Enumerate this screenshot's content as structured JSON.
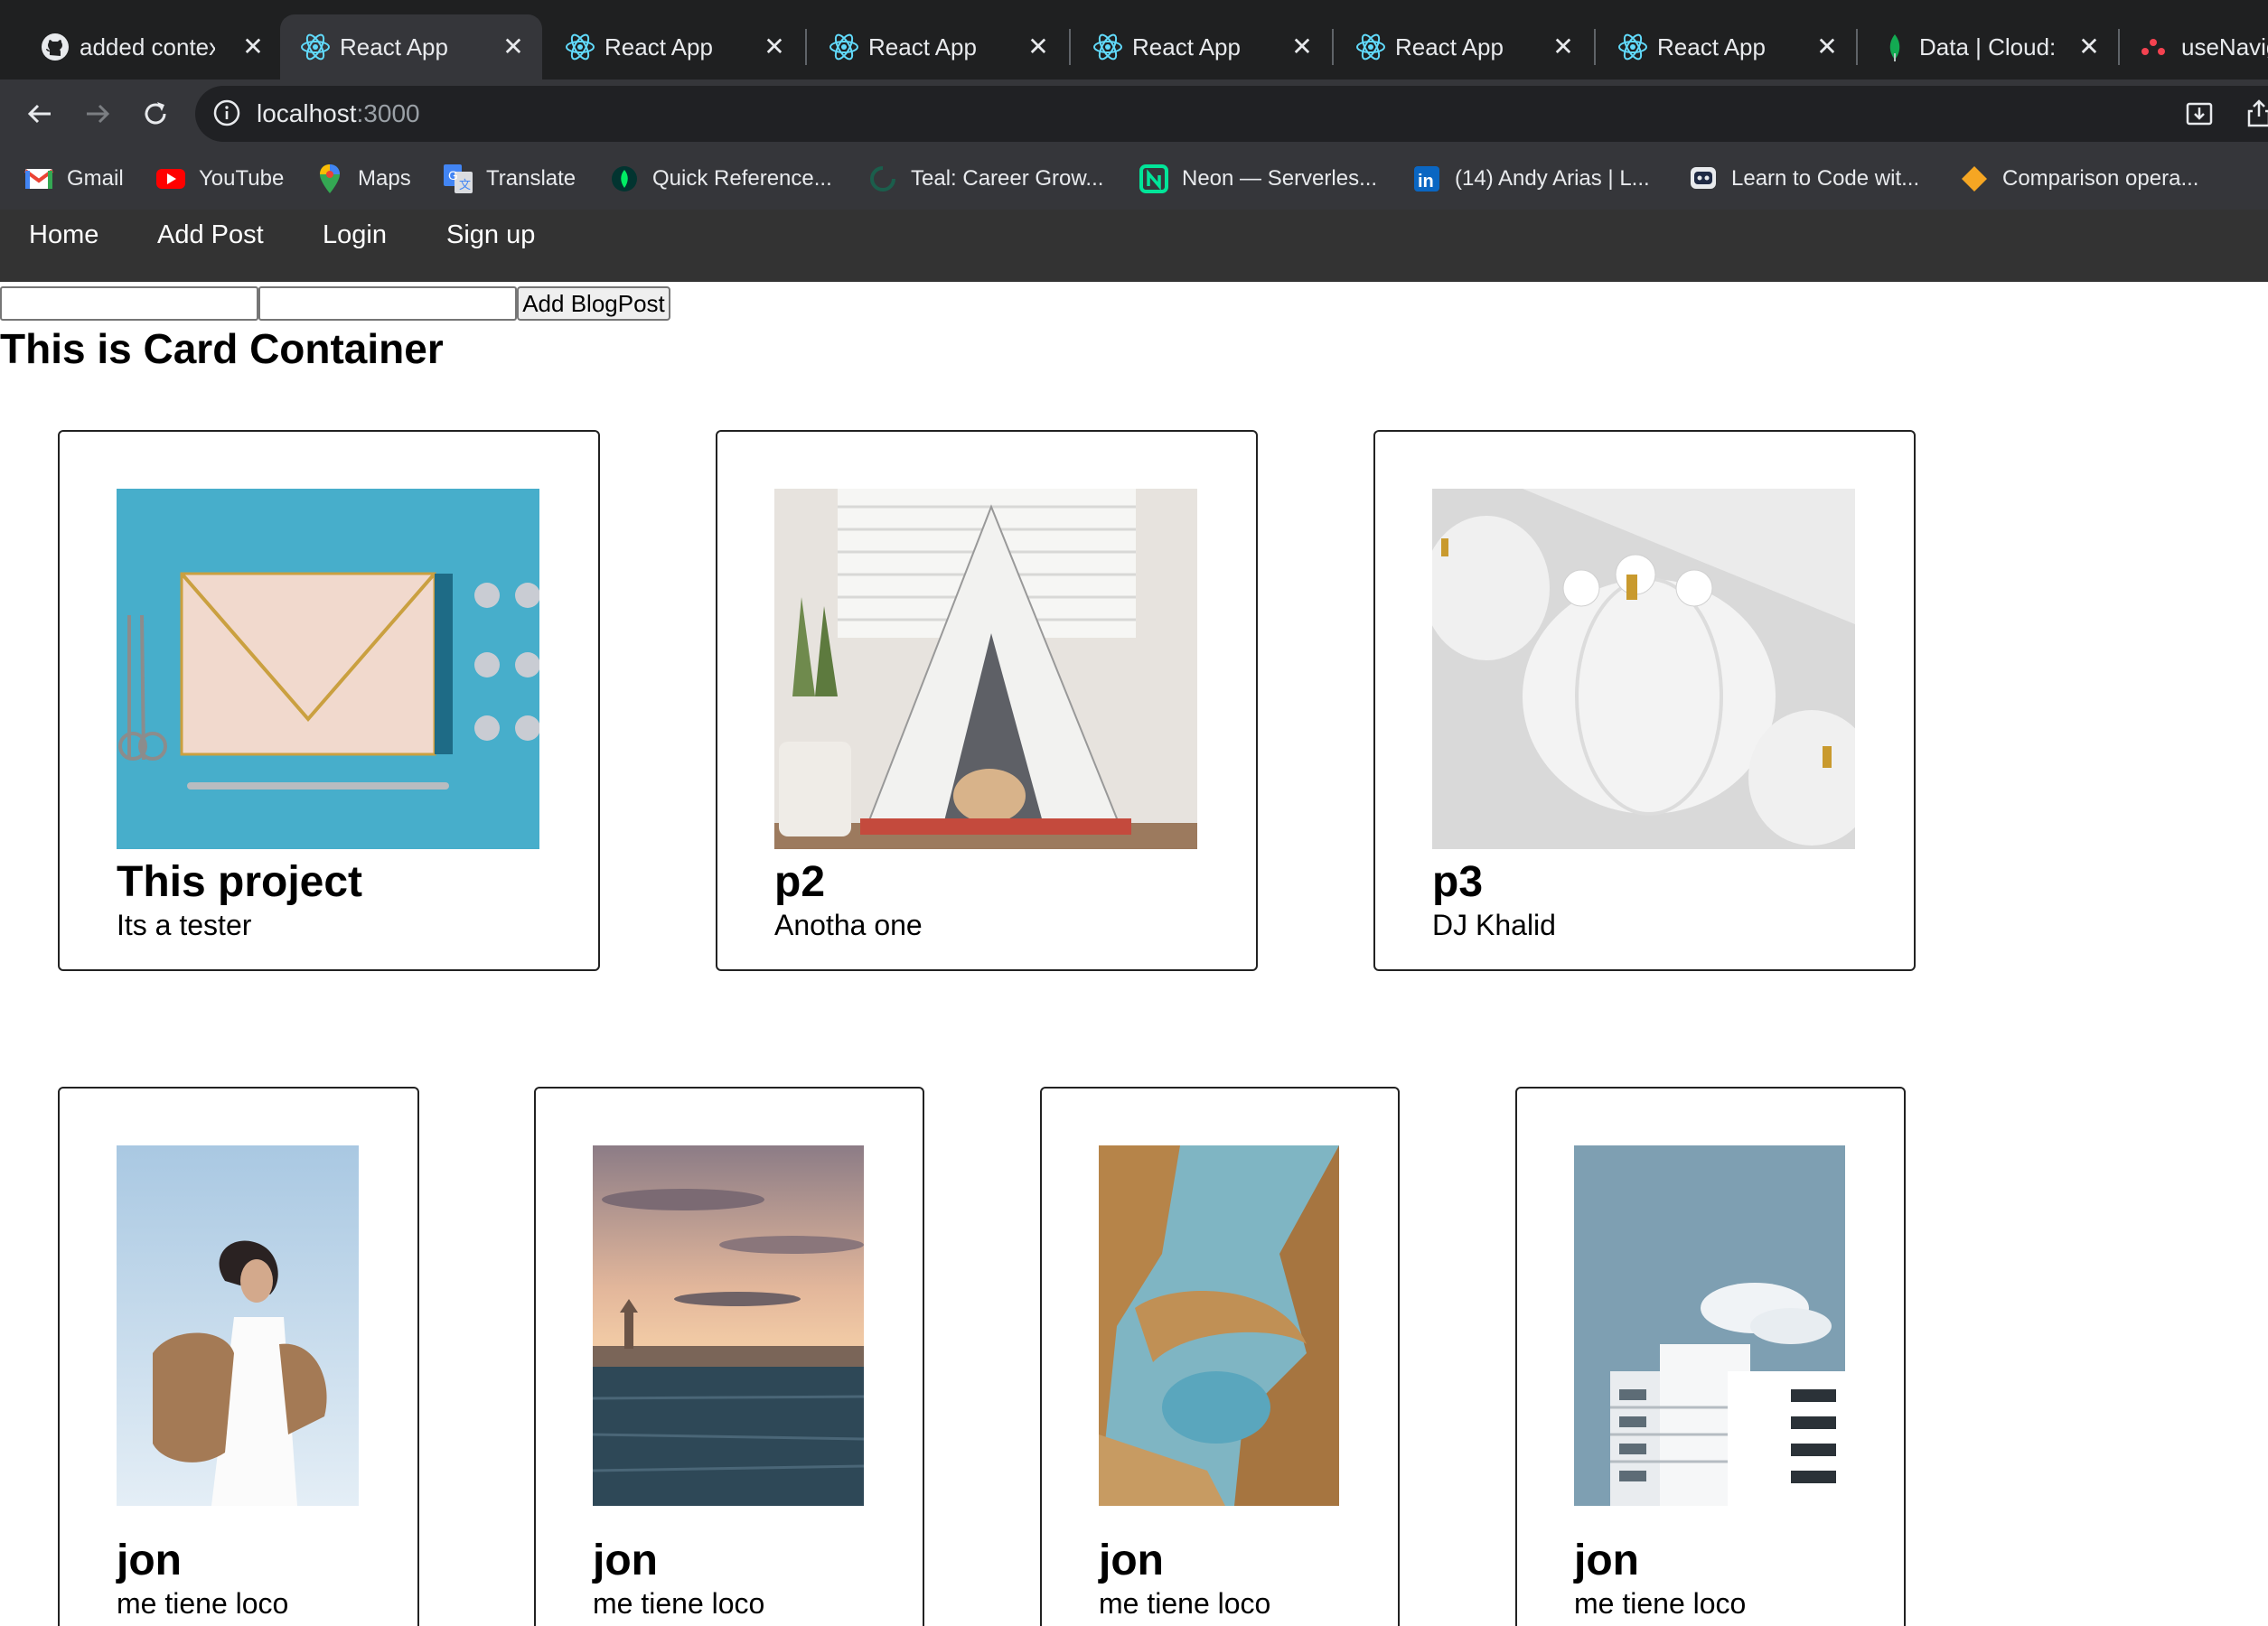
{
  "browser": {
    "tabs": [
      {
        "title": "added contex",
        "icon": "github-icon",
        "active": false
      },
      {
        "title": "React App",
        "icon": "react-icon",
        "active": true
      },
      {
        "title": "React App",
        "icon": "react-icon",
        "active": false
      },
      {
        "title": "React App",
        "icon": "react-icon",
        "active": false
      },
      {
        "title": "React App",
        "icon": "react-icon",
        "active": false
      },
      {
        "title": "React App",
        "icon": "react-icon",
        "active": false
      },
      {
        "title": "React App",
        "icon": "react-icon",
        "active": false
      },
      {
        "title": "Data | Cloud:",
        "icon": "mongodb-leaf-icon",
        "active": false
      },
      {
        "title": "useNavig",
        "icon": "react-router-icon",
        "active": false
      }
    ],
    "address": {
      "host": "localhost",
      "port": ":3000"
    },
    "bookmarks": [
      {
        "label": "Gmail",
        "icon": "gmail-icon"
      },
      {
        "label": "YouTube",
        "icon": "youtube-icon"
      },
      {
        "label": "Maps",
        "icon": "maps-pin-icon"
      },
      {
        "label": "Translate",
        "icon": "translate-icon"
      },
      {
        "label": "Quick Reference...",
        "icon": "mongodb-leaf-icon"
      },
      {
        "label": "Teal: Career Grow...",
        "icon": "teal-icon"
      },
      {
        "label": "Neon — Serverles...",
        "icon": "neon-icon"
      },
      {
        "label": "(14) Andy Arias | L...",
        "icon": "linkedin-icon"
      },
      {
        "label": "Learn to Code wit...",
        "icon": "codecademy-icon"
      },
      {
        "label": "Comparison opera...",
        "icon": "diamond-icon"
      }
    ],
    "colors": {
      "tabbar": "#1f2021",
      "toolbar": "#35363a",
      "text": "#e8eaed"
    }
  },
  "nav": {
    "links": [
      "Home",
      "Add Post",
      "Login",
      "Sign up"
    ],
    "background": "#333333"
  },
  "form": {
    "title_value": "",
    "body_value": "",
    "button_label": "Add BlogPost"
  },
  "heading": "This is Card Container",
  "cards_row1": [
    {
      "title": "This project",
      "desc": "Its a tester",
      "image": "envelope-photo"
    },
    {
      "title": "p2",
      "desc": "Anotha one",
      "image": "teepee-dog-photo"
    },
    {
      "title": "p3",
      "desc": "DJ Khalid",
      "image": "white-pumpkins-photo"
    }
  ],
  "cards_row2": [
    {
      "title": "jon",
      "desc": "me tiene loco",
      "image": "woman-portrait-photo"
    },
    {
      "title": "jon",
      "desc": "me tiene loco",
      "image": "venice-sunset-photo"
    },
    {
      "title": "jon",
      "desc": "me tiene loco",
      "image": "coastal-arch-photo"
    },
    {
      "title": "jon",
      "desc": "me tiene loco",
      "image": "building-photo"
    }
  ]
}
